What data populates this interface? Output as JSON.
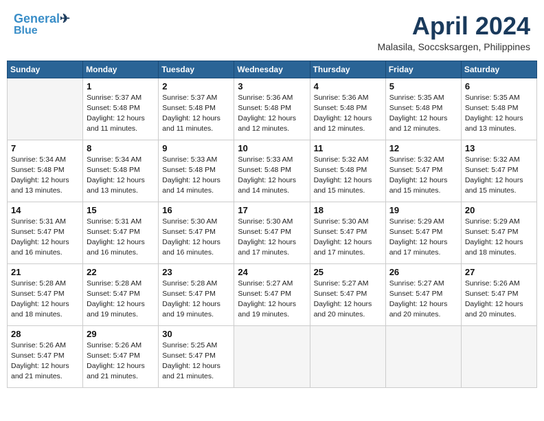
{
  "header": {
    "logo_line1": "General",
    "logo_line2": "Blue",
    "month": "April 2024",
    "location": "Malasila, Soccsksargen, Philippines"
  },
  "days_of_week": [
    "Sunday",
    "Monday",
    "Tuesday",
    "Wednesday",
    "Thursday",
    "Friday",
    "Saturday"
  ],
  "weeks": [
    [
      {
        "day": "",
        "info": ""
      },
      {
        "day": "1",
        "info": "Sunrise: 5:37 AM\nSunset: 5:48 PM\nDaylight: 12 hours\nand 11 minutes."
      },
      {
        "day": "2",
        "info": "Sunrise: 5:37 AM\nSunset: 5:48 PM\nDaylight: 12 hours\nand 11 minutes."
      },
      {
        "day": "3",
        "info": "Sunrise: 5:36 AM\nSunset: 5:48 PM\nDaylight: 12 hours\nand 12 minutes."
      },
      {
        "day": "4",
        "info": "Sunrise: 5:36 AM\nSunset: 5:48 PM\nDaylight: 12 hours\nand 12 minutes."
      },
      {
        "day": "5",
        "info": "Sunrise: 5:35 AM\nSunset: 5:48 PM\nDaylight: 12 hours\nand 12 minutes."
      },
      {
        "day": "6",
        "info": "Sunrise: 5:35 AM\nSunset: 5:48 PM\nDaylight: 12 hours\nand 13 minutes."
      }
    ],
    [
      {
        "day": "7",
        "info": "Sunrise: 5:34 AM\nSunset: 5:48 PM\nDaylight: 12 hours\nand 13 minutes."
      },
      {
        "day": "8",
        "info": "Sunrise: 5:34 AM\nSunset: 5:48 PM\nDaylight: 12 hours\nand 13 minutes."
      },
      {
        "day": "9",
        "info": "Sunrise: 5:33 AM\nSunset: 5:48 PM\nDaylight: 12 hours\nand 14 minutes."
      },
      {
        "day": "10",
        "info": "Sunrise: 5:33 AM\nSunset: 5:48 PM\nDaylight: 12 hours\nand 14 minutes."
      },
      {
        "day": "11",
        "info": "Sunrise: 5:32 AM\nSunset: 5:48 PM\nDaylight: 12 hours\nand 15 minutes."
      },
      {
        "day": "12",
        "info": "Sunrise: 5:32 AM\nSunset: 5:47 PM\nDaylight: 12 hours\nand 15 minutes."
      },
      {
        "day": "13",
        "info": "Sunrise: 5:32 AM\nSunset: 5:47 PM\nDaylight: 12 hours\nand 15 minutes."
      }
    ],
    [
      {
        "day": "14",
        "info": "Sunrise: 5:31 AM\nSunset: 5:47 PM\nDaylight: 12 hours\nand 16 minutes."
      },
      {
        "day": "15",
        "info": "Sunrise: 5:31 AM\nSunset: 5:47 PM\nDaylight: 12 hours\nand 16 minutes."
      },
      {
        "day": "16",
        "info": "Sunrise: 5:30 AM\nSunset: 5:47 PM\nDaylight: 12 hours\nand 16 minutes."
      },
      {
        "day": "17",
        "info": "Sunrise: 5:30 AM\nSunset: 5:47 PM\nDaylight: 12 hours\nand 17 minutes."
      },
      {
        "day": "18",
        "info": "Sunrise: 5:30 AM\nSunset: 5:47 PM\nDaylight: 12 hours\nand 17 minutes."
      },
      {
        "day": "19",
        "info": "Sunrise: 5:29 AM\nSunset: 5:47 PM\nDaylight: 12 hours\nand 17 minutes."
      },
      {
        "day": "20",
        "info": "Sunrise: 5:29 AM\nSunset: 5:47 PM\nDaylight: 12 hours\nand 18 minutes."
      }
    ],
    [
      {
        "day": "21",
        "info": "Sunrise: 5:28 AM\nSunset: 5:47 PM\nDaylight: 12 hours\nand 18 minutes."
      },
      {
        "day": "22",
        "info": "Sunrise: 5:28 AM\nSunset: 5:47 PM\nDaylight: 12 hours\nand 19 minutes."
      },
      {
        "day": "23",
        "info": "Sunrise: 5:28 AM\nSunset: 5:47 PM\nDaylight: 12 hours\nand 19 minutes."
      },
      {
        "day": "24",
        "info": "Sunrise: 5:27 AM\nSunset: 5:47 PM\nDaylight: 12 hours\nand 19 minutes."
      },
      {
        "day": "25",
        "info": "Sunrise: 5:27 AM\nSunset: 5:47 PM\nDaylight: 12 hours\nand 20 minutes."
      },
      {
        "day": "26",
        "info": "Sunrise: 5:27 AM\nSunset: 5:47 PM\nDaylight: 12 hours\nand 20 minutes."
      },
      {
        "day": "27",
        "info": "Sunrise: 5:26 AM\nSunset: 5:47 PM\nDaylight: 12 hours\nand 20 minutes."
      }
    ],
    [
      {
        "day": "28",
        "info": "Sunrise: 5:26 AM\nSunset: 5:47 PM\nDaylight: 12 hours\nand 21 minutes."
      },
      {
        "day": "29",
        "info": "Sunrise: 5:26 AM\nSunset: 5:47 PM\nDaylight: 12 hours\nand 21 minutes."
      },
      {
        "day": "30",
        "info": "Sunrise: 5:25 AM\nSunset: 5:47 PM\nDaylight: 12 hours\nand 21 minutes."
      },
      {
        "day": "",
        "info": ""
      },
      {
        "day": "",
        "info": ""
      },
      {
        "day": "",
        "info": ""
      },
      {
        "day": "",
        "info": ""
      }
    ]
  ]
}
